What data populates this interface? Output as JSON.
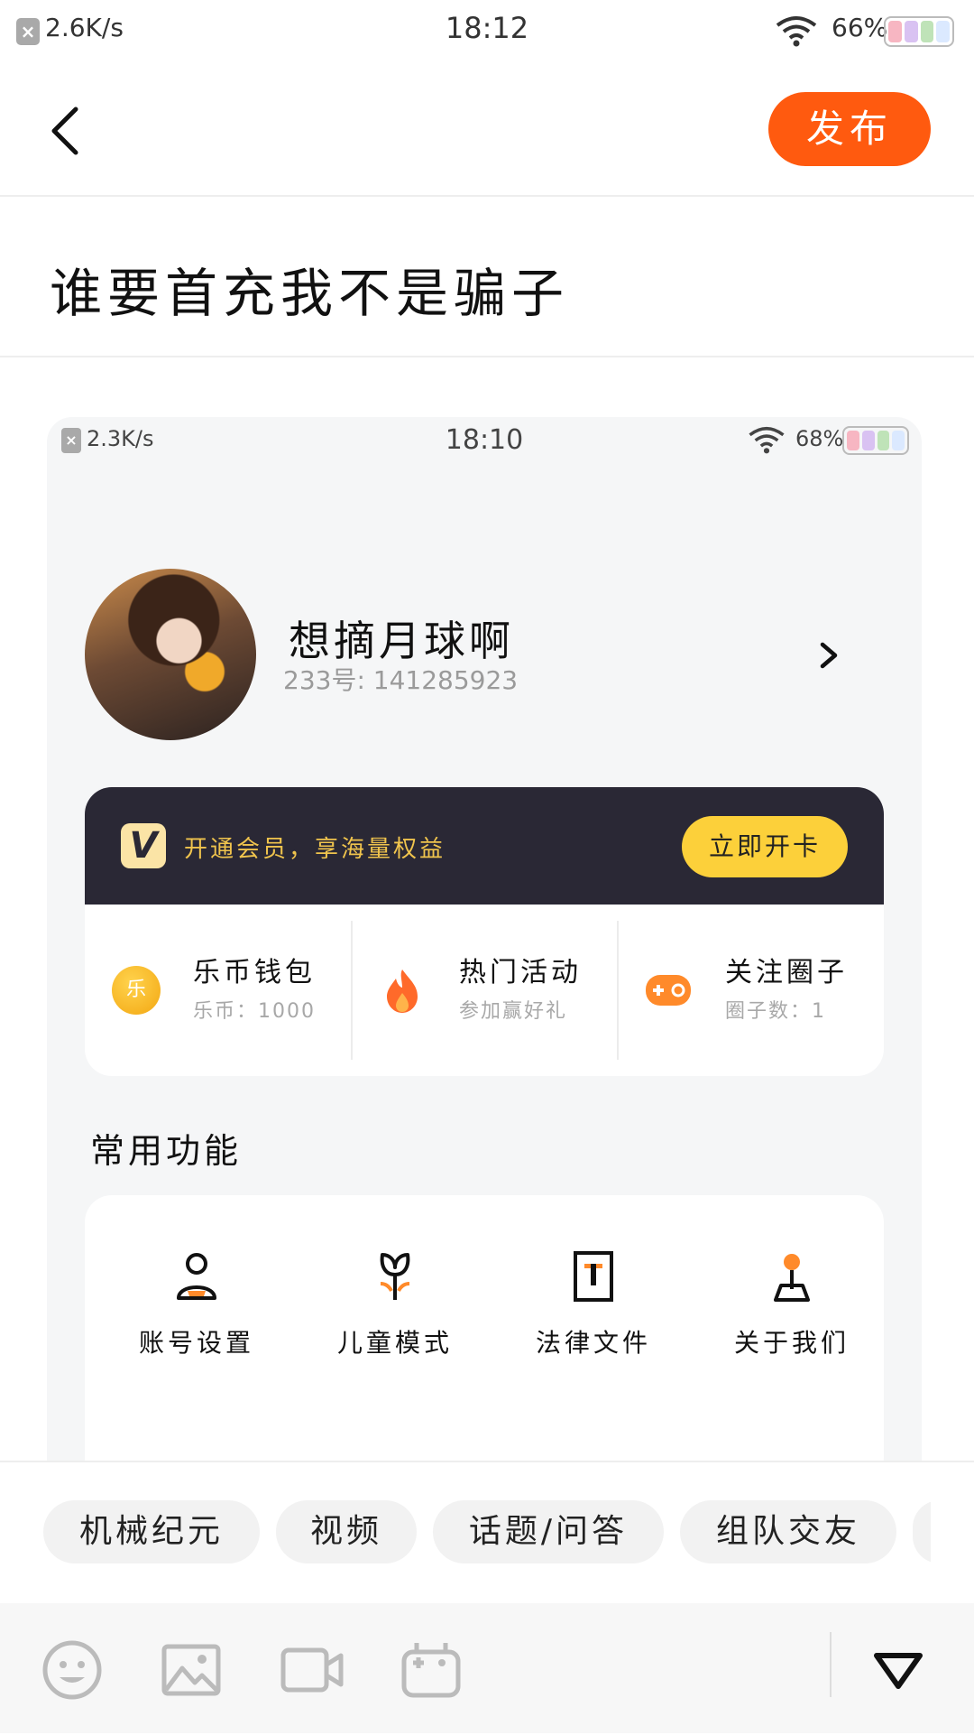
{
  "status_bar": {
    "speed": "2.6K/s",
    "time": "18:12",
    "battery": "66%"
  },
  "header": {
    "publish_label": "发布"
  },
  "post": {
    "title": "谁要首充我不是骗子"
  },
  "embedded": {
    "status_bar": {
      "speed": "2.3K/s",
      "time": "18:10",
      "battery": "68%"
    },
    "profile": {
      "username": "想摘月球啊",
      "user_id": "233号: 141285923"
    },
    "vip": {
      "logo": "V",
      "text": "开通会员，享海量权益",
      "button": "立即开卡"
    },
    "stats": [
      {
        "title": "乐币钱包",
        "sub": "乐币：1000",
        "icon": "coin-icon",
        "icon_text": "乐"
      },
      {
        "title": "热门活动",
        "sub": "参加赢好礼",
        "icon": "fire-icon"
      },
      {
        "title": "关注圈子",
        "sub": "圈子数：1",
        "icon": "gamepad-icon"
      }
    ],
    "common_functions_title": "常用功能",
    "functions": [
      {
        "label": "账号设置",
        "icon": "account-icon"
      },
      {
        "label": "儿童模式",
        "icon": "sprout-icon"
      },
      {
        "label": "法律文件",
        "icon": "document-icon"
      },
      {
        "label": "关于我们",
        "icon": "location-icon"
      }
    ]
  },
  "topics": [
    "机械纪元",
    "视频",
    "话题/问答",
    "组队交友"
  ],
  "toolbar": [
    "emoji-icon",
    "image-icon",
    "video-icon",
    "gamepad-icon",
    "collapse-icon"
  ],
  "colors": {
    "accent": "#ff5a0f",
    "vip_bg": "#2a2835",
    "vip_gold": "#f0c44d",
    "vip_button": "#fcd03a"
  }
}
